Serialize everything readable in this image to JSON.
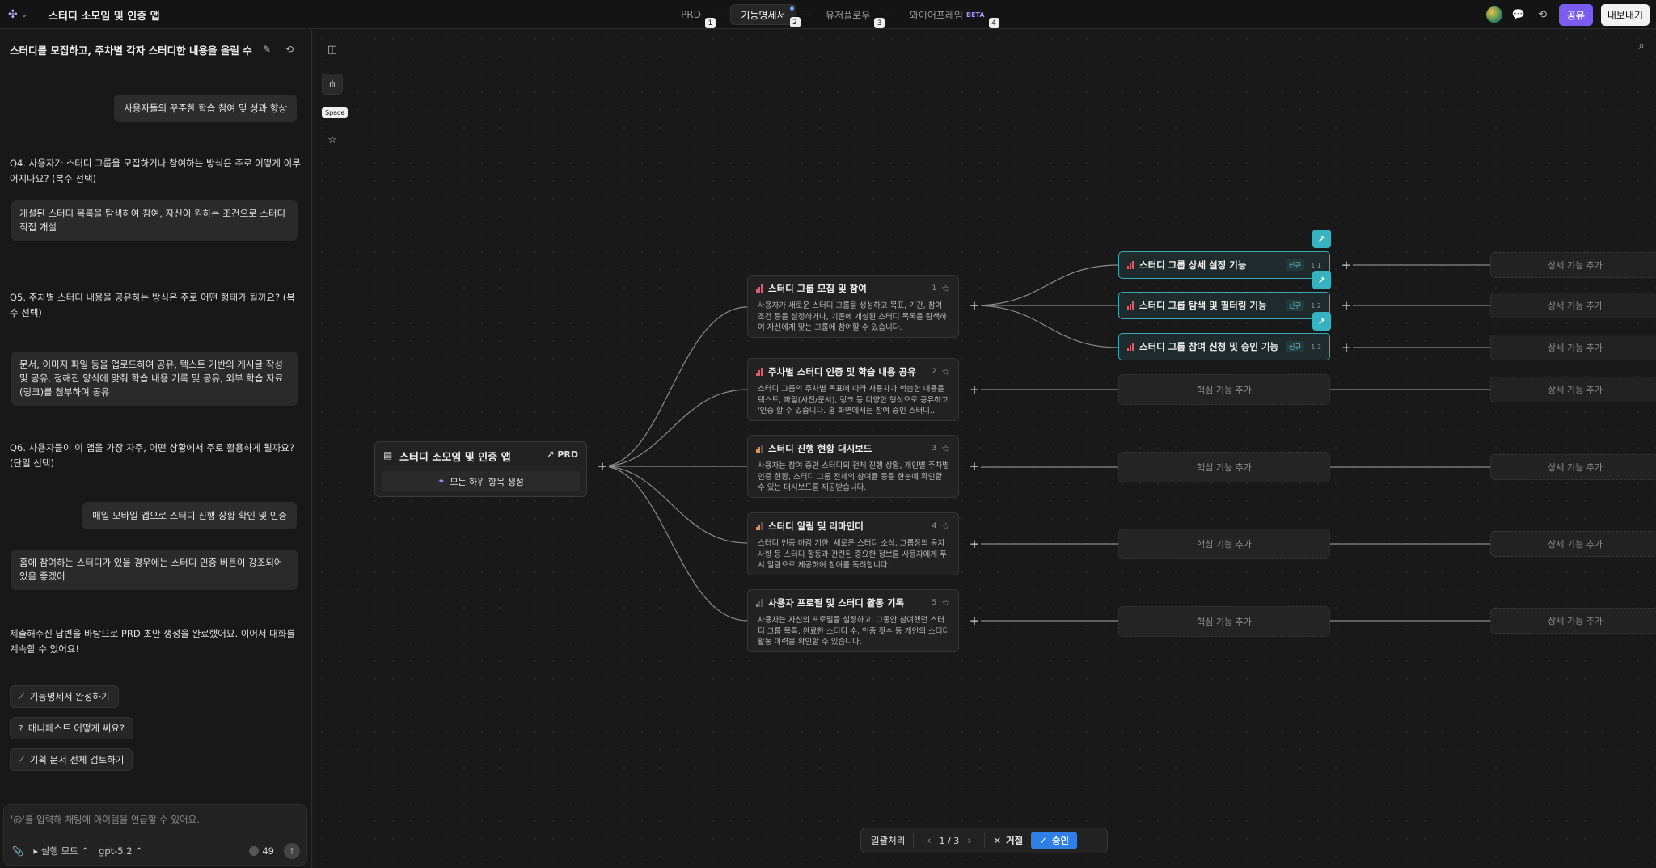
{
  "header": {
    "app_title": "스터디 소모임 및 인증 앱",
    "tabs": [
      {
        "label": "PRD",
        "num": "1"
      },
      {
        "label": "기능명세서",
        "num": "2"
      },
      {
        "label": "유저플로우",
        "num": "3"
      },
      {
        "label": "와이어프레임",
        "num": "4",
        "badge": "BETA"
      }
    ],
    "share_label": "공유",
    "export_label": "내보내기"
  },
  "chat": {
    "title": "스터디를 모집하고, 주차별 각자 스터디한 내용을 올릴 수 있는 ...",
    "user_msg_1": "사용자들의 꾸준한 학습 참여 및 성과 향상",
    "q4": "Q4. 사용자가 스터디 그룹을 모집하거나 참여하는 방식은 주로 어떻게 이루어지나요? (복수 선택)",
    "a4": "개설된 스터디 목록을 탐색하여 참여, 자신이 원하는 조건으로 스터디 직접 개설",
    "q5": "Q5. 주차별 스터디 내용을 공유하는 방식은 주로 어떤 형태가 될까요? (복수 선택)",
    "a5": "문서, 이미지 파일 등을 업로드하여 공유, 텍스트 기반의 게시글 작성 및 공유, 정해진 양식에 맞춰 학습 내용 기록 및 공유, 외부 학습 자료(링크)를 첨부하여 공유",
    "q6": "Q6. 사용자들이 이 앱을 가장 자주, 어떤 상황에서 주로 활용하게 될까요? (단일 선택)",
    "a6": "매일 모바일 앱으로 스터디 진행 상황 확인 및 인증",
    "user_msg_2": "홈에 참여하는 스터디가 있을 경우에는 스터디 인증 버튼이 강조되어있음 좋겠어",
    "ai_done": "제출해주신 답변을 바탕으로 PRD 초안 생성을 완료했어요. 이어서 대화를 계속할 수 있어요!",
    "chips": [
      "기능명세서 완성하기",
      "매니페스트 어떻게 써요?",
      "기획 문서 전체 검토하기"
    ],
    "input_placeholder": "'@'를 입력해 채팅에 아이템을 언급할 수 있어요.",
    "mode_label": "실행 모드",
    "model_label": "gpt-5.2",
    "credits": "49"
  },
  "canvas": {
    "tooltip": "Space",
    "root": {
      "title": "스터디 소모임 및 인증 앱",
      "link_label": "PRD",
      "generate_label": "모든 하위 항목 생성"
    },
    "features": [
      {
        "title": "스터디 그룹 모집 및 참여",
        "num": "1",
        "priority": "high",
        "desc": "사용자가 새로운 스터디 그룹을 생성하고 목표, 기간, 참여 조건 등을 설정하거나, 기존에 개설된 스터디 목록을 탐색하여 자신에게 맞는 그룹에 참여할 수 있습니다."
      },
      {
        "title": "주차별 스터디 인증 및 학습 내용 공유",
        "num": "2",
        "priority": "high",
        "desc": "스터디 그룹의 주차별 목표에 따라 사용자가 학습한 내용을 텍스트, 파일(사진/문서), 링크 등 다양한 형식으로 공유하고 '인증'할 수 있습니다. 홈 화면에서는 참여 중인 스터디..."
      },
      {
        "title": "스터디 진행 현황 대시보드",
        "num": "3",
        "priority": "mid",
        "desc": "사용자는 참여 중인 스터디의 전체 진행 상황, 개인별 주차별 인증 현황, 스터디 그룹 전체의 참여율 등을 한눈에 확인할 수 있는 대시보드를 제공받습니다."
      },
      {
        "title": "스터디 알림 및 리마인더",
        "num": "4",
        "priority": "mid",
        "desc": "스터디 인증 마감 기한, 새로운 스터디 소식, 그룹장의 공지사항 등 스터디 활동과 관련된 중요한 정보를 사용자에게 푸시 알림으로 제공하여 참여를 독려합니다."
      },
      {
        "title": "사용자 프로필 및 스터디 활동 기록",
        "num": "5",
        "priority": "low",
        "desc": "사용자는 자신의 프로필을 설정하고, 그동안 참여했던 스터디 그룹 목록, 완료한 스터디 수, 인증 횟수 등 개인의 스터디 활동 이력을 확인할 수 있습니다."
      }
    ],
    "core_features": [
      {
        "title": "스터디 그룹 상세 설정 기능",
        "tag": "신규",
        "num": "1.1"
      },
      {
        "title": "스터디 그룹 탐색 및 필터링 기능",
        "tag": "신규",
        "num": "1.2"
      },
      {
        "title": "스터디 그룹 참여 신청 및 승인 기능",
        "tag": "신규",
        "num": "1.3"
      }
    ],
    "add_core_label": "핵심 기능 추가",
    "add_detail_label": "상세 기능 추가"
  },
  "review_bar": {
    "batch_label": "일괄처리",
    "page": "1 / 3",
    "reject_label": "거절",
    "approve_label": "승인"
  },
  "colors": {
    "accent_purple": "#7b5cf0",
    "teal": "#36b3bf",
    "approve_blue": "#2f7fe6",
    "priority_high": "#e05a6b",
    "priority_mid": "#e0924a"
  }
}
